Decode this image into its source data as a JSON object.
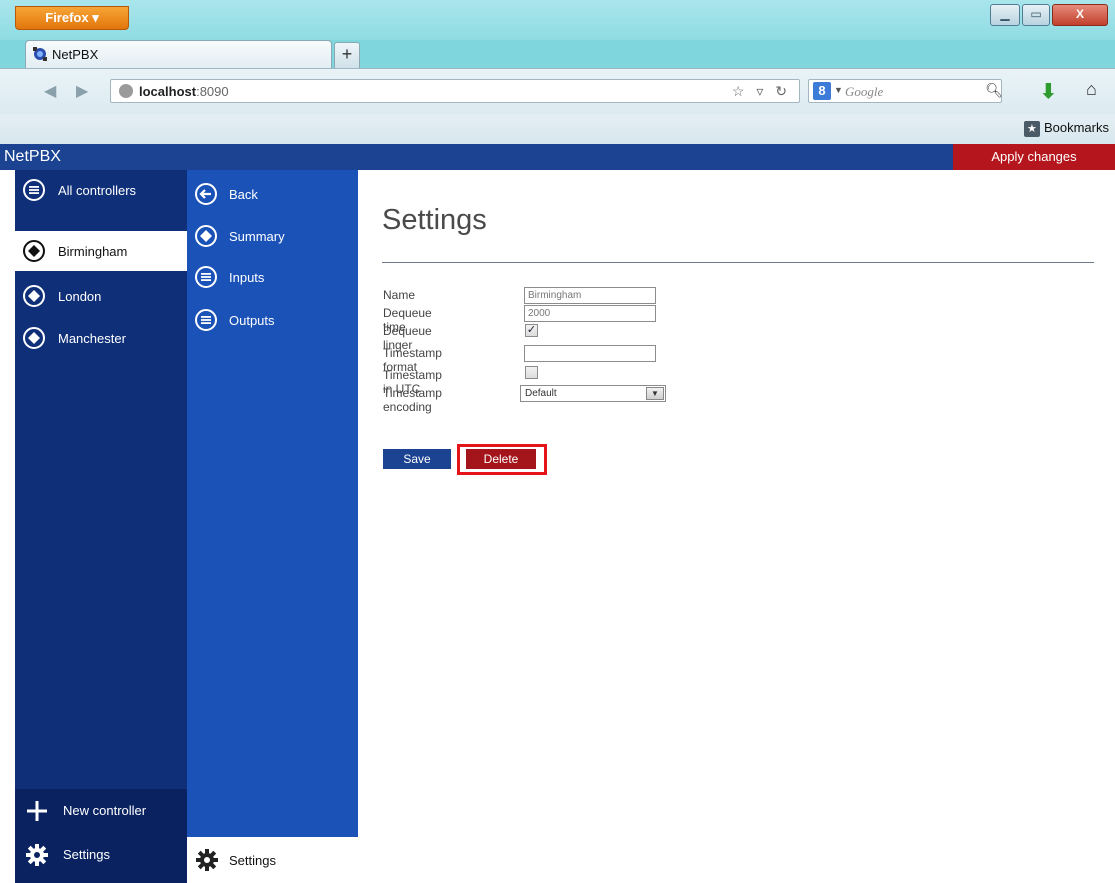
{
  "browser": {
    "menu_button": "Firefox ▾",
    "tab_title": "NetPBX",
    "new_tab": "+",
    "url_host": "localhost",
    "url_port": ":8090",
    "search_placeholder": "Google",
    "search_engine_letter": "8",
    "bookmarks_label": "Bookmarks",
    "window_controls": {
      "minimize": "▁",
      "maximize": "▭",
      "close": "X"
    }
  },
  "app": {
    "title": "NetPBX",
    "apply_label": "Apply changes",
    "controllers": {
      "all_label": "All controllers",
      "items": [
        {
          "label": "Birmingham",
          "selected": true
        },
        {
          "label": "London",
          "selected": false
        },
        {
          "label": "Manchester",
          "selected": false
        }
      ],
      "new_controller": "New controller",
      "settings": "Settings"
    },
    "submenu": {
      "items": [
        "Back",
        "Summary",
        "Inputs",
        "Outputs"
      ],
      "settings": "Settings"
    },
    "page": {
      "title": "Settings",
      "fields": {
        "name_label": "Name",
        "name_value": "Birmingham",
        "dequeue_time_label": "Dequeue time",
        "dequeue_time_value": "2000",
        "dequeue_linger_label": "Dequeue linger",
        "dequeue_linger_checked": true,
        "timestamp_format_label": "Timestamp format",
        "timestamp_format_value": "",
        "timestamp_utc_label": "Timestamp in UTC",
        "timestamp_utc_checked": false,
        "timestamp_encoding_label": "Timestamp encoding",
        "timestamp_encoding_value": "Default"
      },
      "save_label": "Save",
      "delete_label": "Delete"
    }
  },
  "colors": {
    "app_bar": "#1b4392",
    "sidebar_dark": "#0f2f78",
    "sidebar_mid": "#1a52b8",
    "apply_red": "#b5161d",
    "delete_red": "#a3151b",
    "highlight_red": "#e5141b"
  }
}
